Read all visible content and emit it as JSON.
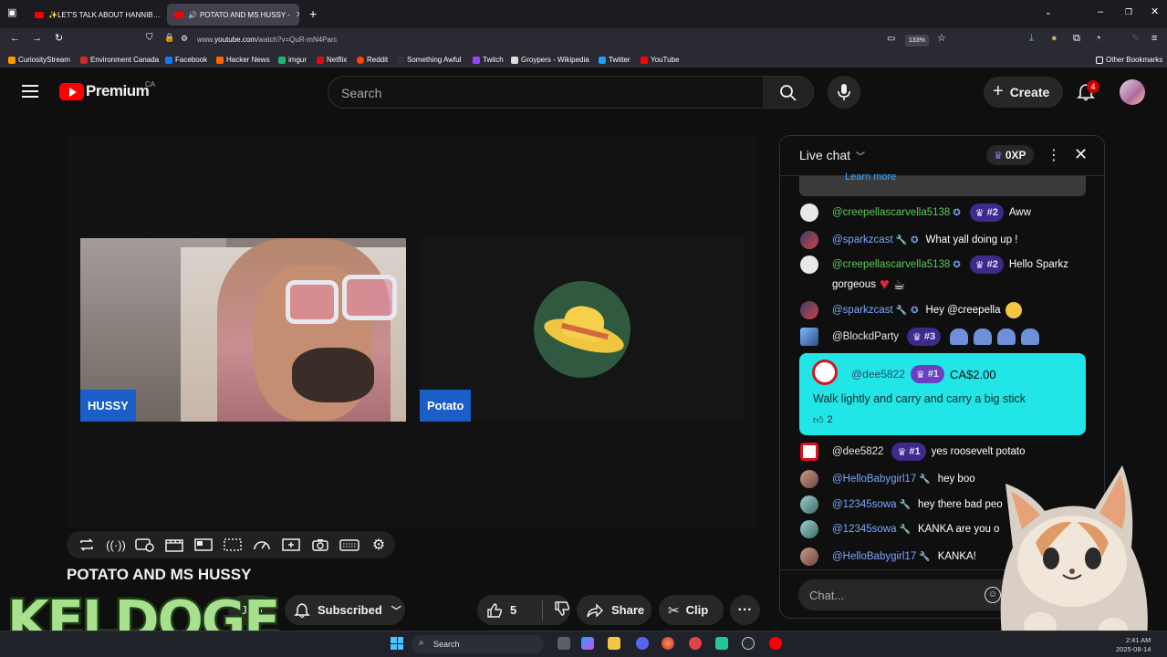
{
  "browser": {
    "tabs": [
      {
        "label": "✨LET'S TALK ABOUT HANNIB…"
      },
      {
        "label": "POTATO AND MS HUSSY -"
      }
    ],
    "url_prefix": "www.",
    "url_domain": "youtube.com",
    "url_path": "/watch?v=QuR-mN4Parc",
    "zoom": "133%",
    "bookmarks": [
      {
        "label": "CuriosityStream",
        "color": "#ff9900"
      },
      {
        "label": "Environment Canada",
        "color": "#d62828"
      },
      {
        "label": "Facebook",
        "color": "#1877f2"
      },
      {
        "label": "Hacker News",
        "color": "#ff6600"
      },
      {
        "label": "imgur",
        "color": "#1bb76e"
      },
      {
        "label": "Netflix",
        "color": "#e50914"
      },
      {
        "label": "Reddit",
        "color": "#ff4500"
      },
      {
        "label": "Something Awful",
        "color": "#333333"
      },
      {
        "label": "Twitch",
        "color": "#9146ff"
      },
      {
        "label": "Groypers - Wikipedia",
        "color": "#dddddd"
      },
      {
        "label": "Twitter",
        "color": "#1da1f2"
      },
      {
        "label": "YouTube",
        "color": "#ff0000"
      }
    ],
    "other_bookmarks": "Other Bookmarks"
  },
  "header": {
    "logo_text": "Premium",
    "region": "CA",
    "search_placeholder": "Search",
    "create_label": "Create",
    "notification_count": "4"
  },
  "player": {
    "tiles": [
      {
        "name": "HUSSY"
      },
      {
        "name": "Potato"
      }
    ]
  },
  "video": {
    "title": "POTATO AND MS HUSSY",
    "join_label": "Join",
    "subscribed_label": "Subscribed",
    "likes": "5",
    "share_label": "Share",
    "clip_label": "Clip"
  },
  "overlay": {
    "keldoge_text": "KELDOGE"
  },
  "chat": {
    "title": "Live chat",
    "xp": "0XP",
    "learn_more": "Learn more",
    "messages": [
      {
        "user": "@creepellascarvella5138",
        "rank": "#2",
        "text": "Aww"
      },
      {
        "user": "@sparkzcast",
        "text": "What yall doing up !"
      },
      {
        "user": "@creepellascarvella5138",
        "rank": "#2",
        "text": "Hello Sparkz",
        "text2": "gorgeous"
      },
      {
        "user": "@sparkzcast",
        "text": "Hey @creepella"
      },
      {
        "user": "@BlockdParty",
        "rank": "#3",
        "text": ""
      },
      {
        "user": "@dee5822",
        "rank": "#1",
        "text": "yes roosevelt potato"
      },
      {
        "user": "@HelloBabygirl17",
        "text": "hey boo"
      },
      {
        "user": "@12345sowa",
        "text": "hey there bad peo"
      },
      {
        "user": "@12345sowa",
        "text": "KANKA are you o"
      },
      {
        "user": "@HelloBabygirl17",
        "text": "KANKA!"
      }
    ],
    "superchat": {
      "user": "@dee5822",
      "rank": "#1",
      "amount": "CA$2.00",
      "text": "Walk lightly and carry and carry a big stick",
      "likes": "2"
    },
    "input_placeholder": "Chat..."
  },
  "taskbar": {
    "search": "Search",
    "time": "2:41 AM",
    "date": "2025-08-14"
  }
}
